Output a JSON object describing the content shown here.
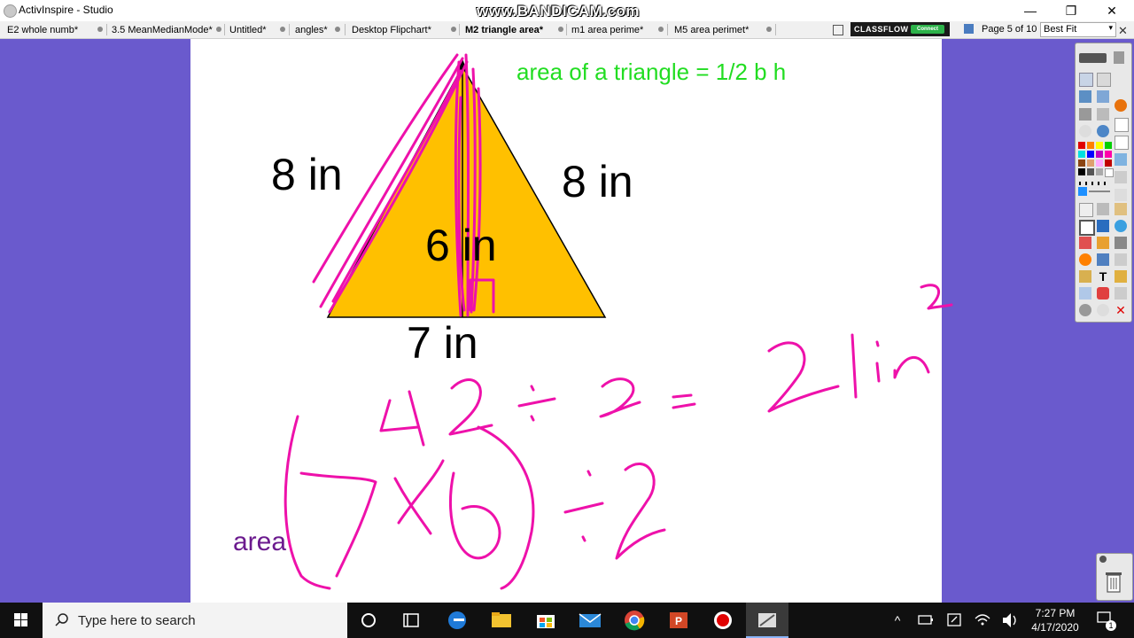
{
  "window": {
    "title": "ActivInspire - Studio",
    "watermark": "www.BANDICAM.com",
    "controls": {
      "minimize": "—",
      "restore": "❐",
      "close": "✕"
    }
  },
  "tabs": [
    {
      "label": "E2 whole  numb*",
      "active": false
    },
    {
      "label": "3.5 MeanMedianMode*",
      "active": false
    },
    {
      "label": "Untitled*",
      "active": false
    },
    {
      "label": "angles*",
      "active": false
    },
    {
      "label": "Desktop Flipchart*",
      "active": false
    },
    {
      "label": "M2 triangle area*",
      "active": true
    },
    {
      "label": "m1 area perime*",
      "active": false
    },
    {
      "label": "M5 area perimet*",
      "active": false
    }
  ],
  "classflow": {
    "brand": "CLASSFLOW",
    "status": "Connect"
  },
  "page_indicator": "Page 5 of 10",
  "zoom": {
    "value": "Best Fit"
  },
  "flipchart": {
    "formula": "area of a triangle = 1/2 b h",
    "left_side": "8 in",
    "right_side": "8 in",
    "height": "6 in",
    "base": "7 in",
    "area_label": "area",
    "triangle_fill": "#ffc000",
    "ink_color": "#ee11aa"
  },
  "taskbar": {
    "search_placeholder": "Type here to search",
    "time": "7:27 PM",
    "date": "4/17/2020",
    "notification_count": "1"
  },
  "colors": {
    "desktop_bg": "#6a5acd",
    "formula_text": "#22dd22",
    "area_label": "#6b1a8e"
  }
}
